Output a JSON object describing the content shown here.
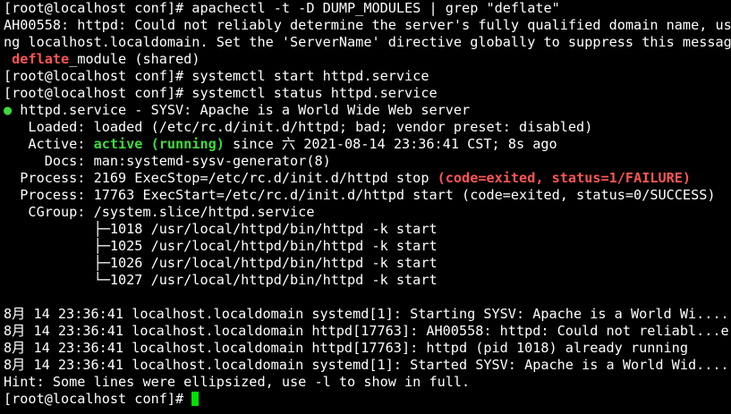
{
  "colors": {
    "background": "#000000",
    "foreground": "#ffffff",
    "error_red": "#ff5555",
    "active_green": "#3cdc3c",
    "cursor_green": "#00e000"
  },
  "lines": {
    "l1": "[root@localhost conf]# apachectl -t -D DUMP_MODULES | grep \"deflate\"",
    "l2": "AH00558: httpd: Could not reliably determine the server's fully qualified domain name, usi",
    "l3": "ng localhost.localdomain. Set the 'ServerName' directive globally to suppress this message",
    "l4_pre": " ",
    "l4_highlight": "deflate",
    "l4_post": "_module (shared)",
    "l5": "[root@localhost conf]# systemctl start httpd.service",
    "l6": "[root@localhost conf]# systemctl status httpd.service",
    "l7_dot": "●",
    "l7_text": " httpd.service - SYSV: Apache is a World Wide Web server",
    "l8": "   Loaded: loaded (/etc/rc.d/init.d/httpd; bad; vendor preset: disabled)",
    "l9_pre": "   Active: ",
    "l9_status": "active (running)",
    "l9_post": " since 六 2021-08-14 23:36:41 CST; 8s ago",
    "l10": "     Docs: man:systemd-sysv-generator(8)",
    "l11_pre": "  Process: 2169 ExecStop=/etc/rc.d/init.d/httpd stop ",
    "l11_error": "(code=exited, status=1/FAILURE)",
    "l12": "  Process: 17763 ExecStart=/etc/rc.d/init.d/httpd start (code=exited, status=0/SUCCESS)",
    "l13": "   CGroup: /system.slice/httpd.service",
    "l14": "           ├─1018 /usr/local/httpd/bin/httpd -k start",
    "l15": "           ├─1025 /usr/local/httpd/bin/httpd -k start",
    "l16": "           ├─1026 /usr/local/httpd/bin/httpd -k start",
    "l17": "           └─1027 /usr/local/httpd/bin/httpd -k start",
    "l18": "",
    "l19": "8月 14 23:36:41 localhost.localdomain systemd[1]: Starting SYSV: Apache is a World Wi....",
    "l20": "8月 14 23:36:41 localhost.localdomain httpd[17763]: AH00558: httpd: Could not reliabl...e",
    "l21": "8月 14 23:36:41 localhost.localdomain httpd[17763]: httpd (pid 1018) already running",
    "l22": "8月 14 23:36:41 localhost.localdomain systemd[1]: Started SYSV: Apache is a World Wid....",
    "l23": "Hint: Some lines were ellipsized, use -l to show in full.",
    "l24_prompt": "[root@localhost conf]# "
  }
}
